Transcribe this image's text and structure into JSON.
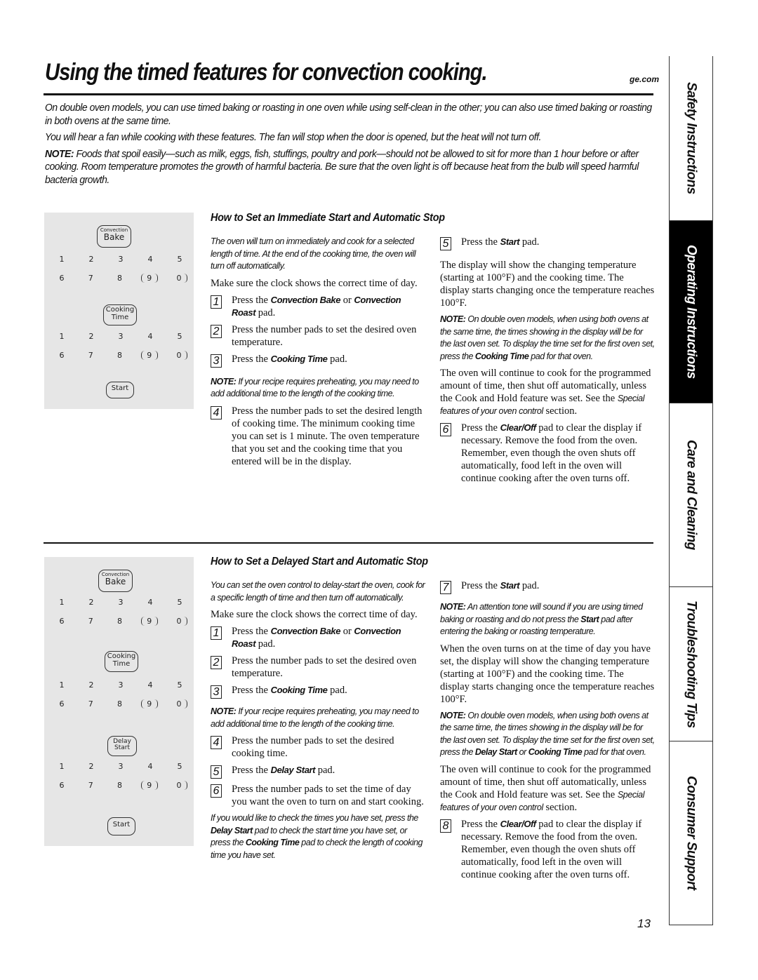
{
  "header": {
    "title": "Using the timed features for convection cooking.",
    "site": "ge.com"
  },
  "intro": {
    "p1": "On double oven models, you can use timed baking or roasting in one oven while using self-clean in the other; you can also use timed baking or roasting in both ovens at the same time.",
    "p2": "You will hear a fan while cooking with these features. The fan will stop when the door is opened, but the heat will not turn off.",
    "note_label": "NOTE:",
    "note": " Foods that spoil easily—such as milk, eggs, fish, stuffings, poultry and pork—should not be allowed to sit for more than 1 hour before or after cooking. Room temperature promotes the growth of harmful bacteria. Be sure that the oven light is off because heat from the bulb will speed harmful bacteria growth."
  },
  "keypad": {
    "convection_small": "Convection",
    "convection_big": "Bake",
    "cooking_1": "Cooking",
    "cooking_2": "Time",
    "delay_1": "Delay",
    "delay_2": "Start",
    "start": "Start",
    "row1": [
      "1",
      "2",
      "3",
      "4",
      "5"
    ],
    "row2": [
      "6",
      "7",
      "8",
      "9",
      "0"
    ]
  },
  "section1": {
    "heading": "How to Set an Immediate Start and Automatic Stop",
    "lead": "The oven will turn on immediately and cook for a selected length of time. At the end of the cooking time, the oven will turn off automatically.",
    "clock": "Make sure the clock shows the correct time of day.",
    "s1_num": "1",
    "s1_a": "Press the ",
    "s1_k1": "Convection Bake",
    "s1_b": " or ",
    "s1_k2": "Convection Roast",
    "s1_c": " pad.",
    "s2_num": "2",
    "s2": "Press the number pads to set the desired oven temperature.",
    "s3_num": "3",
    "s3_a": "Press the ",
    "s3_k": "Cooking Time",
    "s3_b": " pad.",
    "note_label": "NOTE:",
    "note": " If your recipe requires preheating, you may need to add additional time to the length of the cooking time.",
    "s4_num": "4",
    "s4": "Press the number pads to set the desired length of cooking time. The minimum cooking time you can set is 1 minute. The oven temperature that you set and the cooking time that you entered will be in the display.",
    "s5_num": "5",
    "s5_a": "Press the ",
    "s5_k": "Start",
    "s5_b": " pad.",
    "display": "The display will show the changing temperature (starting at 100°F) and the cooking time. The display starts changing once the temperature reaches 100°F.",
    "note2_label": "NOTE:",
    "note2_a": " On double oven models, when using both ovens at the same time, the times showing in the display will be for the last oven set. To display the time set for the first oven set, press the ",
    "note2_k": "Cooking Time",
    "note2_b": " pad for that oven.",
    "continue_a": "The oven will continue to cook for the programmed amount of time, then shut off automatically, unless the Cook and Hold feature was set. See the ",
    "continue_i": "Special features of your oven control",
    "continue_b": " section.",
    "s6_num": "6",
    "s6_a": "Press the ",
    "s6_k": "Clear/Off",
    "s6_b": " pad to clear the display if necessary. Remove the food from the oven. Remember, even though the oven shuts off automatically, food left in the oven will continue cooking after the oven turns off."
  },
  "section2": {
    "heading": "How to Set a Delayed Start and Automatic Stop",
    "lead": "You can set the oven control to delay-start the oven, cook for a specific length of time and then turn off automatically.",
    "clock": "Make sure the clock shows the correct time of day.",
    "s1_num": "1",
    "s1_a": "Press the ",
    "s1_k1": "Convection Bake",
    "s1_b": " or ",
    "s1_k2": "Convection Roast",
    "s1_c": " pad.",
    "s2_num": "2",
    "s2": "Press the number pads to set the desired oven temperature.",
    "s3_num": "3",
    "s3_a": "Press the ",
    "s3_k": "Cooking Time",
    "s3_b": " pad.",
    "note_label": "NOTE:",
    "note": " If your recipe requires preheating, you may need to add additional time to the length of the cooking time.",
    "s4_num": "4",
    "s4": "Press the number pads to set the desired cooking time.",
    "s5_num": "5",
    "s5_a": "Press the ",
    "s5_k": "Delay Start",
    "s5_b": " pad.",
    "s6_num": "6",
    "s6": "Press the number pads to set the time of day you want the oven to turn on and start cooking.",
    "check_a": "If you would like to check the times you have set, press the ",
    "check_k1": "Delay Start",
    "check_b": " pad to check the start time you have set, or press the ",
    "check_k2": "Cooking Time",
    "check_c": " pad to check the length of cooking time you have set.",
    "s7_num": "7",
    "s7_a": "Press the ",
    "s7_k": "Start",
    "s7_b": " pad.",
    "note2_label": "NOTE:",
    "note2_a": " An attention tone will sound if you are using timed baking or roasting and do not press the ",
    "note2_k": "Start",
    "note2_b": " pad after entering the baking or roasting temperature.",
    "turns_on": "When the oven turns on at the time of day you have set, the display will show the changing temperature (starting at 100°F) and the cooking time. The display starts changing once the temperature reaches 100°F.",
    "note3_label": "NOTE:",
    "note3_a": " On double oven models, when using both ovens at the same time, the times showing in the display will be for the last oven set. To display the time set for the first oven set, press the ",
    "note3_k1": "Delay Start",
    "note3_b": " or ",
    "note3_k2": "Cooking Time",
    "note3_c": " pad for that oven.",
    "continue_a": "The oven will continue to cook for the programmed amount of time, then shut off automatically, unless the Cook and Hold feature was set. See the ",
    "continue_i": "Special features of your oven control",
    "continue_b": " section.",
    "s8_num": "8",
    "s8_a": "Press the ",
    "s8_k": "Clear/Off",
    "s8_b": " pad to clear the display if necessary. Remove the food from the oven. Remember, even though the oven shuts off automatically, food left in the oven will continue cooking after the oven turns off."
  },
  "page_number": "13",
  "side_tabs": [
    {
      "label": "Safety Instructions",
      "active": false
    },
    {
      "label": "Operating Instructions",
      "active": true
    },
    {
      "label": "Care and Cleaning",
      "active": false
    },
    {
      "label": "Troubleshooting Tips",
      "active": false
    },
    {
      "label": "Consumer Support",
      "active": false
    }
  ]
}
